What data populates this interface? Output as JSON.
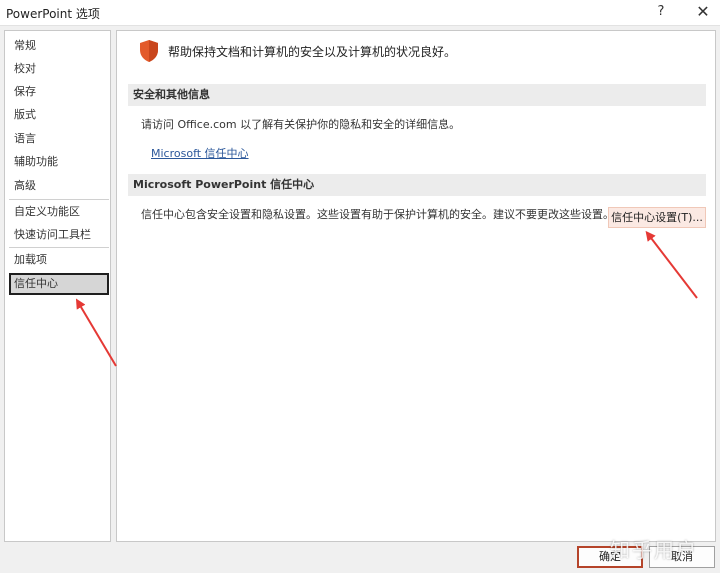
{
  "window": {
    "title": "PowerPoint 选项",
    "help_glyph": "?",
    "close_glyph": "✕"
  },
  "sidebar": {
    "items": [
      {
        "label": "常规"
      },
      {
        "label": "校对"
      },
      {
        "label": "保存"
      },
      {
        "label": "版式"
      },
      {
        "label": "语言"
      },
      {
        "label": "辅助功能"
      },
      {
        "label": "高级"
      },
      {
        "label": "自定义功能区"
      },
      {
        "label": "快速访问工具栏"
      },
      {
        "label": "加载项"
      },
      {
        "label": "信任中心"
      }
    ],
    "active_item": "信任中心"
  },
  "main": {
    "headline": "帮助保持文档和计算机的安全以及计算机的状况良好。",
    "privacy_section": {
      "header": "安全和其他信息",
      "description": "请访问 Office.com 以了解有关保护你的隐私和安全的详细信息。",
      "link_label": "Microsoft 信任中心"
    },
    "trust_center_section": {
      "header": "Microsoft PowerPoint 信任中心",
      "description": "信任中心包含安全设置和隐私设置。这些设置有助于保护计算机的安全。建议不要更改这些设置。",
      "button_label": "信任中心设置(T)..."
    }
  },
  "footer": {
    "ok_label": "确定",
    "cancel_label": "取消"
  },
  "watermark": "知乎用户",
  "colors": {
    "shield": "#e35a2b",
    "annotation_arrow": "#e53935",
    "link": "#2b579a",
    "active_nav_border": "#1f1f1f"
  }
}
